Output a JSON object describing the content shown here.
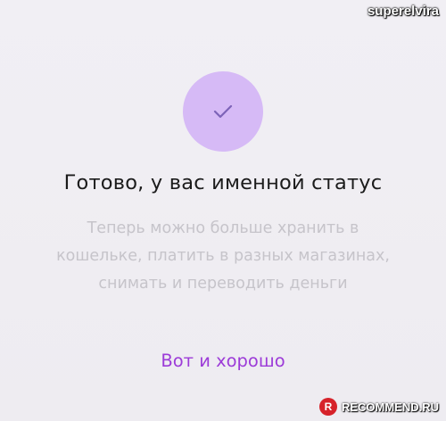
{
  "watermark": {
    "username": "superelvira",
    "site": "RECOMMEND.RU",
    "logo_letter": "R"
  },
  "status_screen": {
    "icon": "checkmark-icon",
    "title": "Готово, у вас именной статус",
    "description": "Теперь можно больше хранить в кошельке, платить в разных магазинах, снимать и переводить деньги",
    "action_label": "Вот и хорошо"
  },
  "colors": {
    "accent": "#9c3bd8",
    "circle": "#d6baf6",
    "check": "#7d63b8",
    "background": "#efedf2"
  }
}
